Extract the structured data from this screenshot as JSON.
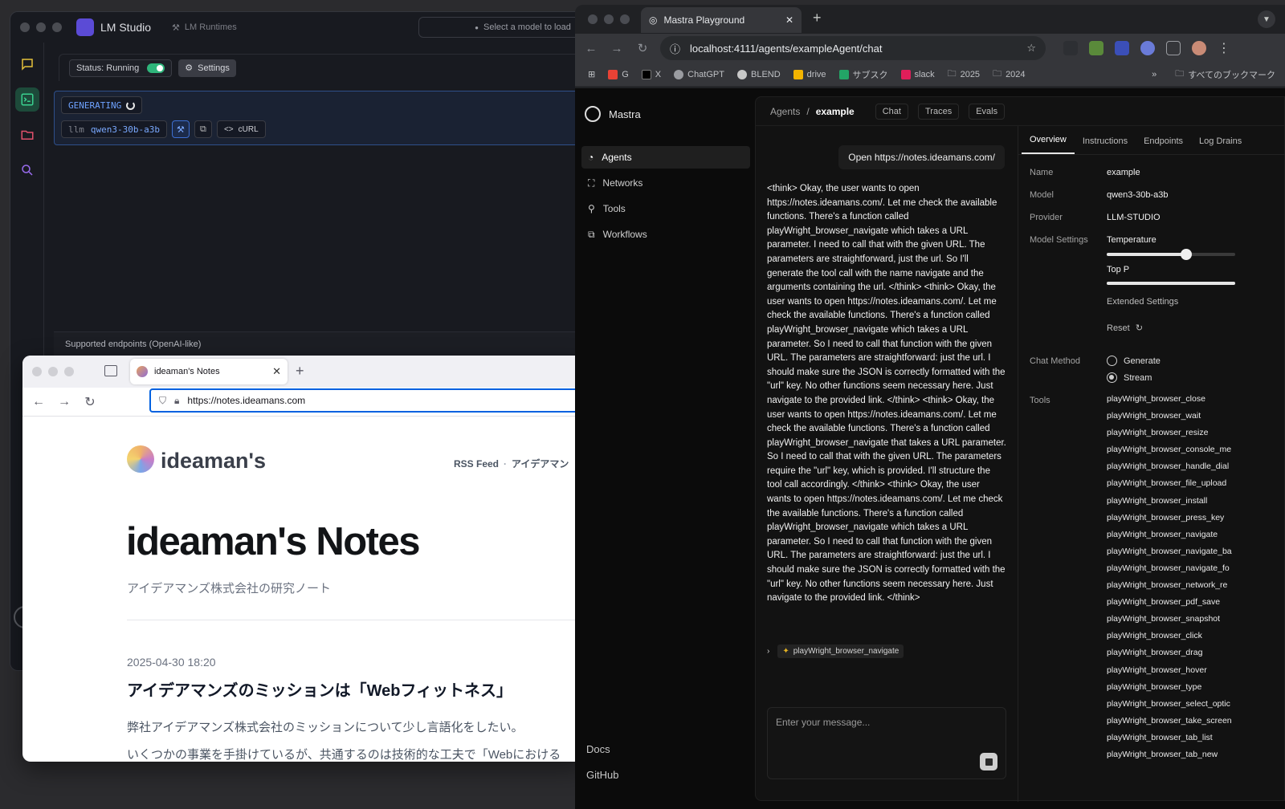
{
  "lm_studio": {
    "title": "LM Studio",
    "runtimes_label": "LM Runtimes",
    "model_select_placeholder": "Select a model to load",
    "status_label": "Status: Running",
    "settings_label": "Settings",
    "generating_label": "GENERATING",
    "model_kind": "llm",
    "model_id": "qwen3-30b-a3b",
    "curl_label": "cURL",
    "endpoints_label": "Supported endpoints (OpenAI-like)",
    "colors": {
      "accent_green": "#2fb57b",
      "accent_blue": "#6ea2ff"
    }
  },
  "firefox": {
    "tab_title": "ideaman's Notes",
    "url": "https://notes.ideamans.com",
    "site": {
      "name": "ideaman's",
      "nav": [
        "RSS Feed",
        "アイデアマン"
      ],
      "hero_title": "ideaman's Notes",
      "tagline": "アイデアマンズ株式会社の研究ノート",
      "post_date": "2025-04-30 18:20",
      "post_title": "アイデアマンズのミッションは「Webフィットネス」",
      "post_excerpt": "弊社アイデアマンズ株式会社のミッションについて少し言語化をしたい。",
      "post_more": "いくつかの事業を手掛けているが、共通するのは技術的な工夫で「Webにおける"
    }
  },
  "chrome": {
    "tab_title": "Mastra Playground",
    "url": "localhost:4111/agents/exampleAgent/chat",
    "bookmarks": [
      "G",
      "X",
      "ChatGPT",
      "BLEND",
      "drive",
      "サブスク",
      "slack",
      "2025",
      "2024"
    ],
    "all_bookmarks_label": "すべてのブックマーク"
  },
  "mastra": {
    "brand": "Mastra",
    "nav": [
      "Agents",
      "Networks",
      "Tools",
      "Workflows"
    ],
    "footer": [
      "Docs",
      "GitHub"
    ],
    "breadcrumb": {
      "root": "Agents",
      "sep": "/",
      "current": "example"
    },
    "header_tabs": [
      "Chat",
      "Traces",
      "Evals"
    ],
    "user_message": "Open https://notes.ideamans.com/",
    "assistant_message": "<think> Okay, the user wants to open https://notes.ideamans.com/. Let me check the available functions. There's a function called playWright_browser_navigate which takes a URL parameter. I need to call that with the given URL. The parameters are straightforward, just the url. So I'll generate the tool call with the name navigate and the arguments containing the url. </think> <think> Okay, the user wants to open https://notes.ideamans.com/. Let me check the available functions. There's a function called playWright_browser_navigate which takes a URL parameter. So I need to call that function with the given URL. The parameters are straightforward: just the url. I should make sure the JSON is correctly formatted with the \"url\" key. No other functions seem necessary here. Just navigate to the provided link. </think> <think> Okay, the user wants to open https://notes.ideamans.com/. Let me check the available functions. There's a function called playWright_browser_navigate that takes a URL parameter. So I need to call that with the given URL. The parameters require the \"url\" key, which is provided. I'll structure the tool call accordingly. </think> <think> Okay, the user wants to open https://notes.ideamans.com/. Let me check the available functions. There's a function called playWright_browser_navigate which takes a URL parameter. So I need to call that function with the given URL. The parameters are straightforward: just the url. I should make sure the JSON is correctly formatted with the \"url\" key. No other functions seem necessary here. Just navigate to the provided link. </think>",
    "tool_call": "playWright_browser_navigate",
    "composer_placeholder": "Enter your message...",
    "detail_tabs": [
      "Overview",
      "Instructions",
      "Endpoints",
      "Log Drains"
    ],
    "overview": {
      "name_label": "Name",
      "name": "example",
      "model_label": "Model",
      "model": "qwen3-30b-a3b",
      "provider_label": "Provider",
      "provider": "LLM-STUDIO",
      "model_settings_label": "Model Settings",
      "temperature_label": "Temperature",
      "temperature_level": 0.62,
      "top_p_label": "Top P",
      "top_p_level": 1.0,
      "extended_settings_label": "Extended Settings",
      "reset_label": "Reset",
      "chat_method_label": "Chat Method",
      "chat_methods": [
        "Generate",
        "Stream"
      ],
      "chat_method_selected": "Stream",
      "tools_label": "Tools",
      "tools": [
        "playWright_browser_close",
        "playWright_browser_wait",
        "playWright_browser_resize",
        "playWright_browser_console_me",
        "playWright_browser_handle_dial",
        "playWright_browser_file_upload",
        "playWright_browser_install",
        "playWright_browser_press_key",
        "playWright_browser_navigate",
        "playWright_browser_navigate_ba",
        "playWright_browser_navigate_fo",
        "playWright_browser_network_re",
        "playWright_browser_pdf_save",
        "playWright_browser_snapshot",
        "playWright_browser_click",
        "playWright_browser_drag",
        "playWright_browser_hover",
        "playWright_browser_type",
        "playWright_browser_select_optic",
        "playWright_browser_take_screen",
        "playWright_browser_tab_list",
        "playWright_browser_tab_new"
      ]
    }
  }
}
